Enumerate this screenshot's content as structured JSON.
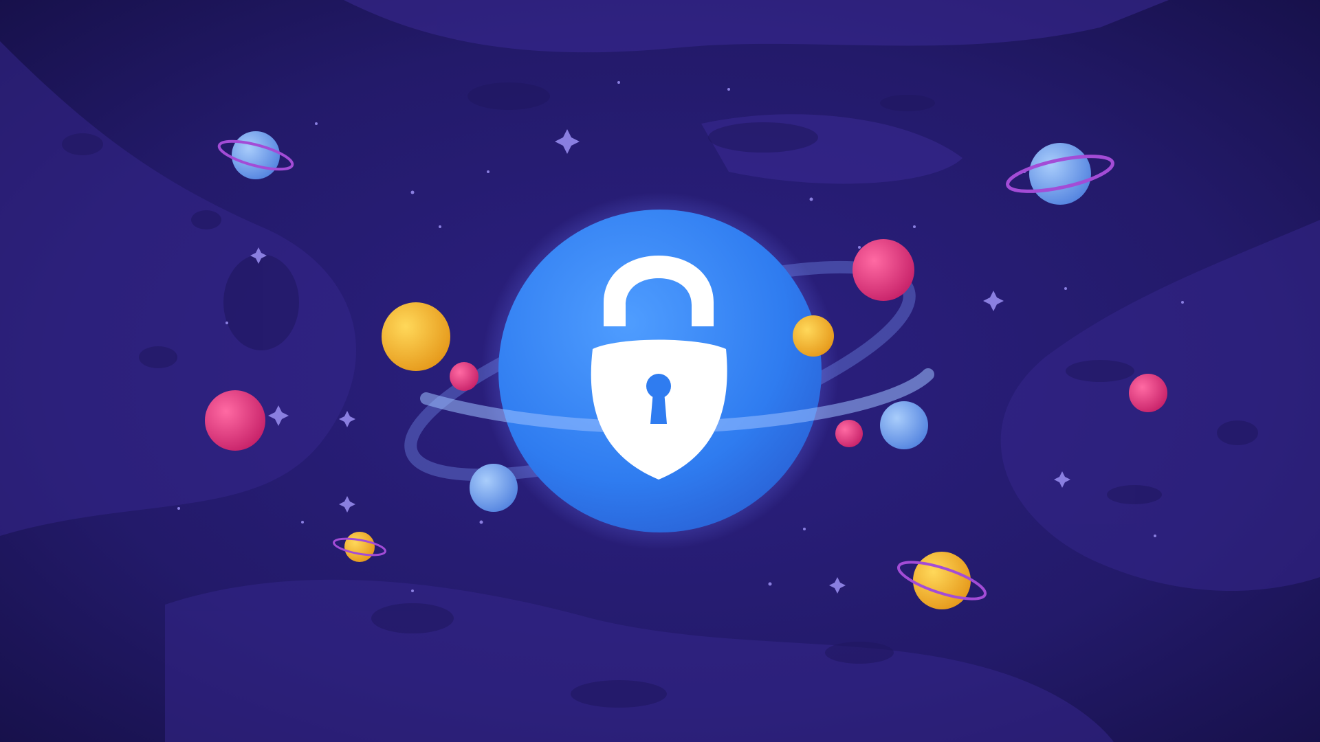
{
  "scene": {
    "subject": "padlock-shield-icon",
    "background": "space-nebula",
    "colors": {
      "background_dark": "#191450",
      "background_mid": "#2a1f7a",
      "nebula": "#3b2a93",
      "nebula_hole": "#1f1760",
      "globe": "#2f7cf0",
      "globe_light": "#4c9cff",
      "orbit": "#7c9cf5",
      "lock": "#ffffff",
      "keyhole": "#2f7cf0",
      "planet_yellow": "#f5b72c",
      "planet_pink": "#e93b7f",
      "planet_blue": "#6fa6f2",
      "ring": "#a34cd6",
      "star": "#8a7fe0"
    }
  }
}
